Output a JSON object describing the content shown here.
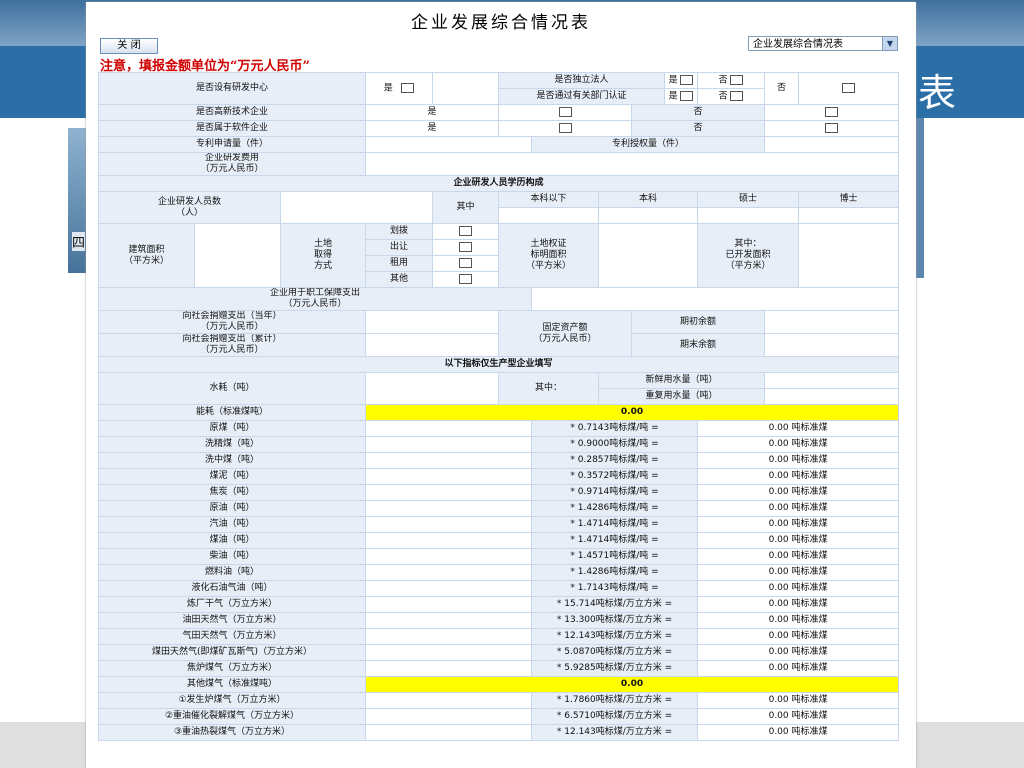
{
  "window": {
    "title": "企业发展综合情况表",
    "close_label": "关 闭",
    "select_value": "企业发展综合情况表",
    "notice": "注意，填报金额单位为“万元人民币”"
  },
  "background": {
    "title_fragment": "表",
    "left_char": "四"
  },
  "yes": "是",
  "no": "否",
  "rows": {
    "rd_center": "是否设有研发中心",
    "independent_legal": "是否独立法人",
    "dept_certified": "是否通过有关部门认证",
    "hightech": "是否高新技术企业",
    "software": "是否属于软件企业",
    "patent_apply": "专利申请量（件）",
    "patent_grant": "专利授权量（件）",
    "rd_cost_1": "企业研发费用",
    "rd_cost_2": "（万元人民币）",
    "rd_edu": "企业研发人员学历构成",
    "rd_count_1": "企业研发人员数",
    "rd_count_2": "（人）",
    "among": "其中",
    "edu_cols": [
      "本科以下",
      "本科",
      "硕士",
      "博士"
    ],
    "build_area_1": "建筑面积",
    "build_area_2": "（平方米）",
    "land_method": [
      "土地",
      "取得",
      "方式"
    ],
    "land_options": [
      "划拨",
      "出让",
      "租用",
      "其他"
    ],
    "land_cert": [
      "土地权证",
      "标明面积",
      "（平方米）"
    ],
    "developed": [
      "其中：",
      "已开发面积",
      "（平方米）"
    ],
    "welfare_1": "企业用于职工保障支出",
    "welfare_2": "（万元人民币）",
    "donate_year_1": "向社会捐赠支出（当年）",
    "donate_year_2": "（万元人民币）",
    "donate_total_1": "向社会捐赠支出（累计）",
    "donate_total_2": "（万元人民币）",
    "fixed_assets_1": "固定资产额",
    "fixed_assets_2": "（万元人民币）",
    "opening_balance": "期初余额",
    "closing_balance": "期末余额",
    "production_only": "以下指标仅生产型企业填写",
    "water": "水耗（吨）",
    "among_colon": "其中：",
    "fresh_water": "新鲜用水量（吨）",
    "reuse_water": "重复用水量（吨）",
    "energy": "能耗（标准煤吨）",
    "energy_total": "0.00",
    "other_gas": "其他煤气（标准煤吨）",
    "other_gas_total": "0.00"
  },
  "fuels": [
    {
      "name": "原煤（吨）",
      "factor": "* 0.7143吨标煤/吨 =",
      "result": "0.00 吨标准煤"
    },
    {
      "name": "洗精煤（吨）",
      "factor": "* 0.9000吨标煤/吨 =",
      "result": "0.00 吨标准煤"
    },
    {
      "name": "洗中煤（吨）",
      "factor": "* 0.2857吨标煤/吨 =",
      "result": "0.00 吨标准煤"
    },
    {
      "name": "煤泥（吨）",
      "factor": "* 0.3572吨标煤/吨 =",
      "result": "0.00 吨标准煤"
    },
    {
      "name": "焦炭（吨）",
      "factor": "* 0.9714吨标煤/吨 =",
      "result": "0.00 吨标准煤"
    },
    {
      "name": "原油（吨）",
      "factor": "* 1.4286吨标煤/吨 =",
      "result": "0.00 吨标准煤"
    },
    {
      "name": "汽油（吨）",
      "factor": "* 1.4714吨标煤/吨 =",
      "result": "0.00 吨标准煤"
    },
    {
      "name": "煤油（吨）",
      "factor": "* 1.4714吨标煤/吨 =",
      "result": "0.00 吨标准煤"
    },
    {
      "name": "柴油（吨）",
      "factor": "* 1.4571吨标煤/吨 =",
      "result": "0.00 吨标准煤"
    },
    {
      "name": "燃料油（吨）",
      "factor": "* 1.4286吨标煤/吨 =",
      "result": "0.00 吨标准煤"
    },
    {
      "name": "液化石油气油（吨）",
      "factor": "* 1.7143吨标煤/吨 =",
      "result": "0.00 吨标准煤"
    },
    {
      "name": "炼厂干气（万立方米）",
      "factor": "* 15.714吨标煤/万立方米 =",
      "result": "0.00 吨标准煤"
    },
    {
      "name": "油田天然气（万立方米）",
      "factor": "* 13.300吨标煤/万立方米 =",
      "result": "0.00 吨标准煤"
    },
    {
      "name": "气田天然气（万立方米）",
      "factor": "* 12.143吨标煤/万立方米 =",
      "result": "0.00 吨标准煤"
    },
    {
      "name": "煤田天然气(即煤矿瓦斯气)（万立方米）",
      "factor": "* 5.0870吨标煤/万立方米 =",
      "result": "0.00 吨标准煤"
    },
    {
      "name": "焦炉煤气（万立方米）",
      "factor": "* 5.9285吨标煤/万立方米 =",
      "result": "0.00 吨标准煤"
    }
  ],
  "gases": [
    {
      "name": "①发生炉煤气（万立方米）",
      "factor": "* 1.7860吨标煤/万立方米 =",
      "result": "0.00 吨标准煤"
    },
    {
      "name": "②重油催化裂解煤气（万立方米）",
      "factor": "* 6.5710吨标煤/万立方米 =",
      "result": "0.00 吨标准煤"
    },
    {
      "name": "③重油热裂煤气（万立方米）",
      "factor": "* 12.143吨标煤/万立方米 =",
      "result": "0.00 吨标准煤"
    }
  ]
}
